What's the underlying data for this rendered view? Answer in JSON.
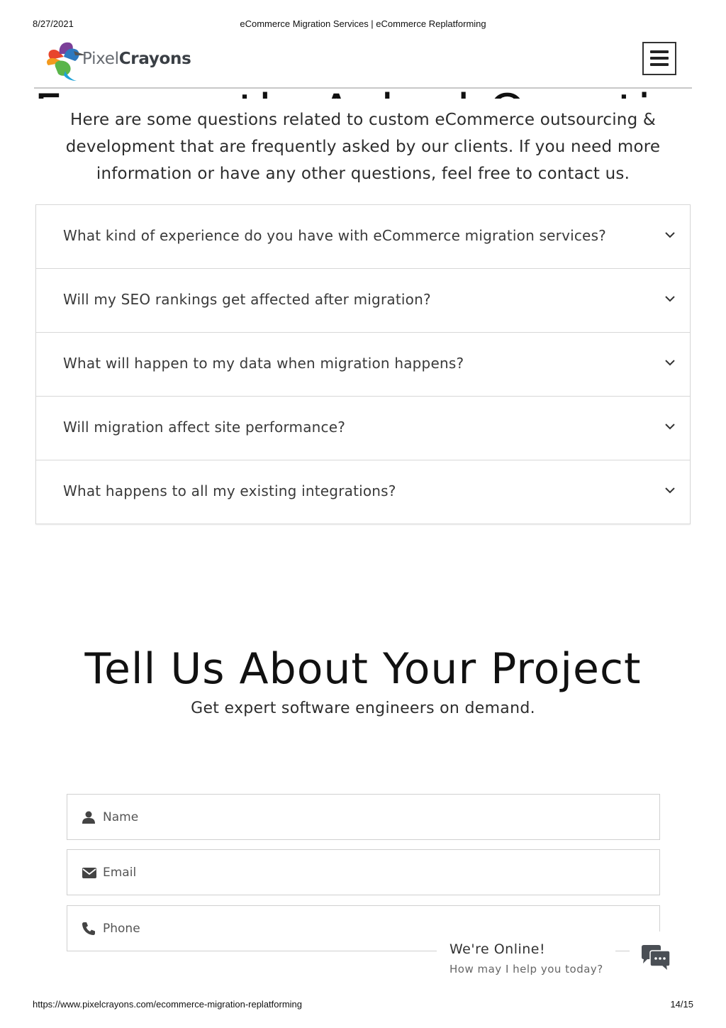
{
  "print_header": {
    "date": "8/27/2021",
    "title": "eCommerce Migration Services | eCommerce Replatforming"
  },
  "print_footer": {
    "url": "https://www.pixelcrayons.com/ecommerce-migration-replatforming",
    "page": "14/15"
  },
  "site_header": {
    "logo_text_1": "Pixel",
    "logo_text_2": "Crayons",
    "menu_icon": "hamburger-menu-icon"
  },
  "faq": {
    "heading": "Frequently Asked Questions",
    "intro": "Here are some questions related to custom eCommerce outsourcing & development that are frequently asked by our clients. If you need more information or have any other questions, feel free to contact us.",
    "items": [
      {
        "question": "What kind of experience do you have with eCommerce migration services?"
      },
      {
        "question": "Will my SEO rankings get affected after migration?"
      },
      {
        "question": "What will happen to my data when migration happens?"
      },
      {
        "question": "Will migration affect site performance?"
      },
      {
        "question": "What happens to all my existing integrations?"
      }
    ]
  },
  "project": {
    "heading": "Tell Us About Your Project",
    "subheading": "Get expert software engineers on demand.",
    "fields": {
      "name": {
        "placeholder": "Name",
        "icon": "user-icon"
      },
      "email": {
        "placeholder": "Email",
        "icon": "envelope-icon"
      },
      "phone": {
        "placeholder": "Phone",
        "icon": "phone-icon"
      }
    }
  },
  "chat": {
    "title": "We're Online!",
    "subtitle": "How may I help you today?",
    "icon": "chat-bubbles-icon"
  },
  "colors": {
    "text_dark": "#222222",
    "border": "#d8d8d8",
    "chat_icon": "#4a4f55"
  }
}
